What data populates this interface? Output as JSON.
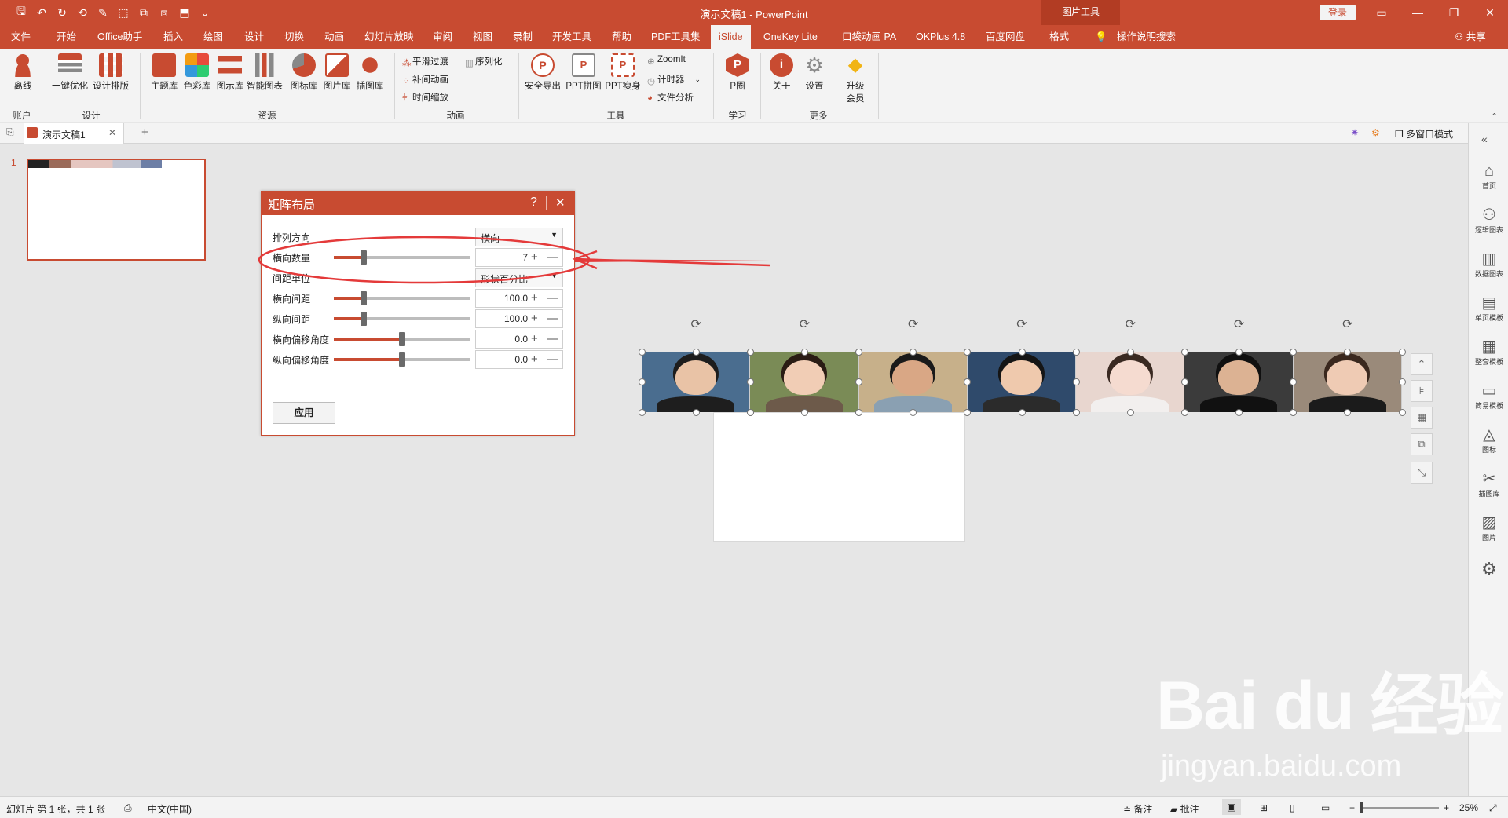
{
  "titlebar": {
    "title": "演示文稿1 - PowerPoint",
    "context_tab": "图片工具",
    "login": "登录"
  },
  "menu": [
    "文件",
    "开始",
    "Office助手",
    "插入",
    "绘图",
    "设计",
    "切换",
    "动画",
    "幻灯片放映",
    "审阅",
    "视图",
    "录制",
    "开发工具",
    "帮助",
    "PDF工具集",
    "iSlide",
    "OneKey Lite",
    "口袋动画 PA",
    "OKPlus 4.8",
    "百度网盘",
    "格式"
  ],
  "menu_active": "iSlide",
  "search_hint": "操作说明搜索",
  "share": "共享",
  "ribbon": {
    "account": {
      "btn": "离线",
      "group": "账户"
    },
    "design": {
      "btns": [
        "一键优化",
        "设计排版"
      ],
      "group": "设计"
    },
    "resources": {
      "btns": [
        "主题库",
        "色彩库",
        "图示库",
        "智能图表",
        "图标库",
        "图片库",
        "插图库"
      ],
      "group": "资源"
    },
    "animation": {
      "items": [
        "平滑过渡",
        "序列化",
        "补间动画",
        "时间缩放"
      ],
      "group": "动画"
    },
    "tools": {
      "btns": [
        "安全导出",
        "PPT拼图",
        "PPT瘦身"
      ],
      "items": [
        "ZoomIt",
        "计时器",
        "文件分析"
      ],
      "group": "工具"
    },
    "learn": {
      "btn": "P圈",
      "group": "学习"
    },
    "more": {
      "btns": [
        "关于",
        "设置",
        "升级会员"
      ],
      "group": "更多"
    }
  },
  "doctab": {
    "name": "演示文稿1",
    "mode": "多窗口模式"
  },
  "thumb": {
    "number": "1"
  },
  "dialog": {
    "title": "矩阵布局",
    "help": "?",
    "rows": [
      {
        "label": "排列方向",
        "type": "select",
        "value": "横向"
      },
      {
        "label": "横向数量",
        "type": "slider",
        "value": "7",
        "level": 0.22
      },
      {
        "label": "间距单位",
        "type": "select",
        "value": "形状百分比"
      },
      {
        "label": "横向间距",
        "type": "slider",
        "value": "100.0",
        "level": 0.22
      },
      {
        "label": "纵向间距",
        "type": "slider",
        "value": "100.0",
        "level": 0.22
      },
      {
        "label": "横向偏移角度",
        "type": "slider",
        "value": "0.0",
        "level": 0.5
      },
      {
        "label": "纵向偏移角度",
        "type": "slider",
        "value": "0.0",
        "level": 0.5
      }
    ],
    "apply": "应用"
  },
  "photos": {
    "count": 7,
    "colors": [
      "#4a6d8f",
      "#7a8b56",
      "#c7b08a",
      "#2f4a6b",
      "#e8d6cf",
      "#3b3b3b",
      "#9a8a7a"
    ]
  },
  "rightpanel": [
    "首页",
    "逻辑图表",
    "数据图表",
    "单页模板",
    "整套模板",
    "简易模板",
    "图标",
    "插图库",
    "图片"
  ],
  "statusbar": {
    "slide_info": "幻灯片 第 1 张，共 1 张",
    "language": "中文(中国)",
    "notes": "备注",
    "comments": "批注",
    "zoom": "25%"
  },
  "watermark": {
    "line1": "Bai du 经验",
    "line2": "jingyan.baidu.com"
  },
  "colors": {
    "accent": "#c84b31",
    "ribbon_bg": "#f3f3f3"
  }
}
